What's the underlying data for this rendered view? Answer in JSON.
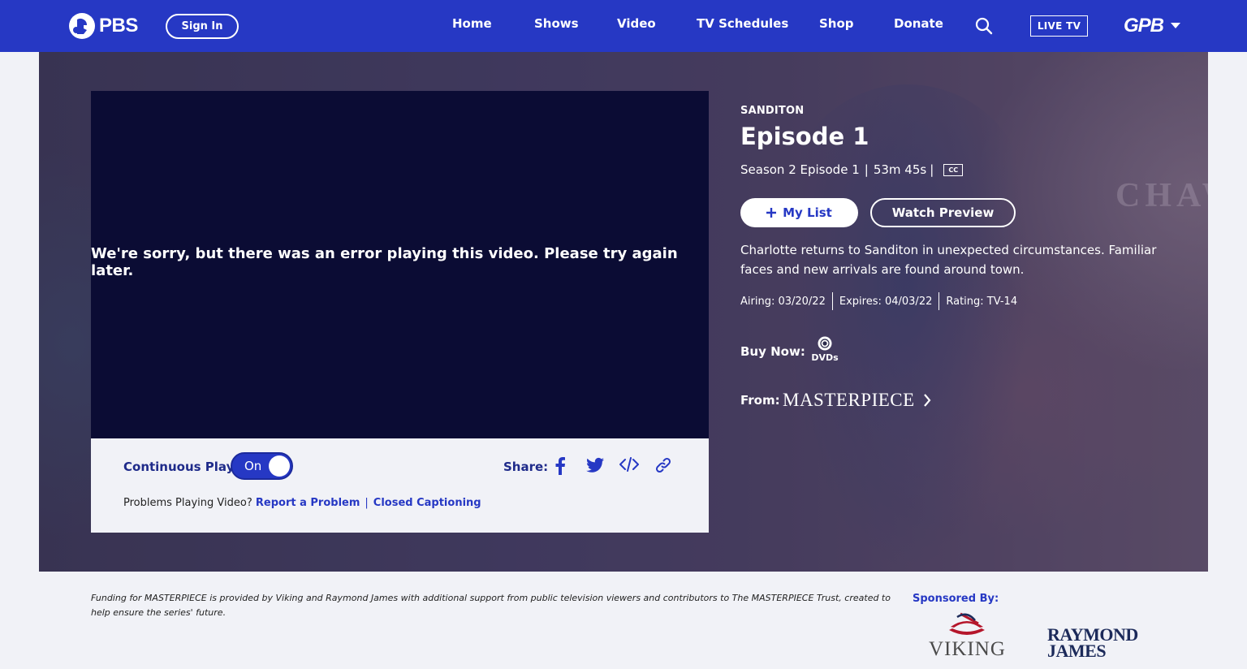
{
  "header": {
    "logo": "PBS",
    "sign_in": "Sign In",
    "nav": [
      "Home",
      "Shows",
      "Video",
      "TV Schedules",
      "Shop",
      "Donate"
    ],
    "live_tv": "LIVE TV",
    "station": "GPB"
  },
  "player": {
    "error_message": "We're sorry, but there was an error playing this video. Please try again later.",
    "continuous_play_label": "Continuous Play:",
    "continuous_play_state": "On",
    "share_label": "Share:",
    "problems_text": "Problems Playing Video?",
    "report_link": "Report a Problem",
    "separator": "|",
    "cc_link": "Closed Captioning"
  },
  "episode": {
    "show": "SANDITON",
    "title": "Episode 1",
    "season_episode": "Season 2 Episode 1",
    "meta_sep": "|",
    "duration": "53m 45s",
    "cc": "CC",
    "my_list": "My List",
    "watch_preview": "Watch Preview",
    "description": "Charlotte returns to Sanditon in unexpected circumstances. Familiar faces and new arrivals are found around town.",
    "airing": "Airing: 03/20/22",
    "expires": "Expires: 04/03/22",
    "rating": "Rating: TV-14",
    "buy_now_label": "Buy Now:",
    "buy_option": "DVDs",
    "from_label": "From:",
    "from_brand": "MASTERPIECE"
  },
  "hero_sign": "CHAWST",
  "footer": {
    "funding": "Funding for MASTERPIECE is provided by Viking and Raymond James with additional support from public television viewers and contributors to The MASTERPIECE Trust, created to help ensure the series' future.",
    "sponsored_label": "Sponsored By:",
    "sponsors": [
      "VIKING",
      "RAYMOND",
      "JAMES"
    ]
  },
  "colors": {
    "brand_blue": "#2638c4",
    "player_bg": "#0b0c34",
    "page_bg": "#f1f2f7"
  }
}
